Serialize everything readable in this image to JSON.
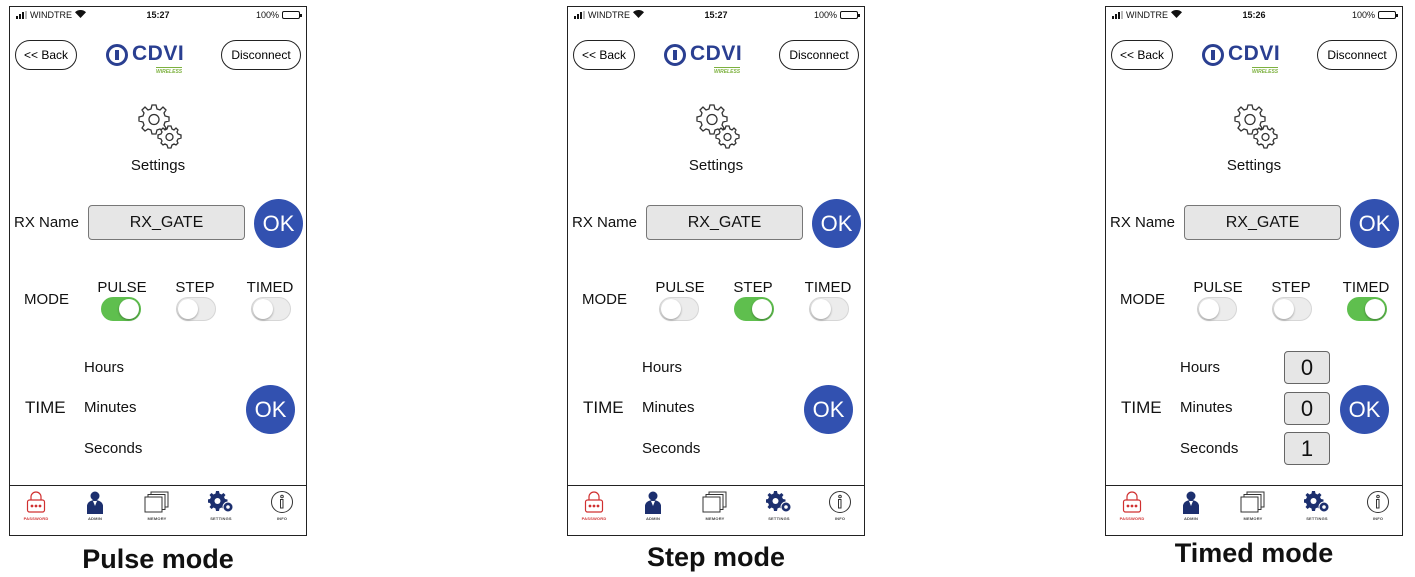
{
  "colors": {
    "brand": "#2a3f91",
    "ok_button": "#3251b0",
    "switch_on": "#5fbf4e",
    "password_tab": "#d03030"
  },
  "screens": [
    {
      "status": {
        "carrier": "WINDTRE",
        "time": "15:27",
        "battery": "100%",
        "charging": true
      },
      "header": {
        "back_label": "<< Back",
        "disconnect_label": "Disconnect",
        "logo_text": "CDVI",
        "logo_sub": "WIRELESS"
      },
      "settings_title": "Settings",
      "rx": {
        "label": "RX Name",
        "value": "RX_GATE",
        "ok_label": "OK"
      },
      "mode": {
        "label": "MODE",
        "options": [
          "PULSE",
          "STEP",
          "TIMED"
        ],
        "selected": "PULSE"
      },
      "time": {
        "label": "TIME",
        "hours_label": "Hours",
        "minutes_label": "Minutes",
        "seconds_label": "Seconds",
        "hours": null,
        "minutes": null,
        "seconds": null,
        "ok_label": "OK"
      },
      "tabs": [
        "PASSWORD",
        "ADMIN",
        "MEMORY",
        "SETTINGS",
        "INFO"
      ],
      "active_tab": "PASSWORD",
      "caption": "Pulse mode"
    },
    {
      "status": {
        "carrier": "WINDTRE",
        "time": "15:27",
        "battery": "100%",
        "charging": true
      },
      "header": {
        "back_label": "<< Back",
        "disconnect_label": "Disconnect",
        "logo_text": "CDVI",
        "logo_sub": "WIRELESS"
      },
      "settings_title": "Settings",
      "rx": {
        "label": "RX Name",
        "value": "RX_GATE",
        "ok_label": "OK"
      },
      "mode": {
        "label": "MODE",
        "options": [
          "PULSE",
          "STEP",
          "TIMED"
        ],
        "selected": "STEP"
      },
      "time": {
        "label": "TIME",
        "hours_label": "Hours",
        "minutes_label": "Minutes",
        "seconds_label": "Seconds",
        "hours": null,
        "minutes": null,
        "seconds": null,
        "ok_label": "OK"
      },
      "tabs": [
        "PASSWORD",
        "ADMIN",
        "MEMORY",
        "SETTINGS",
        "INFO"
      ],
      "active_tab": "PASSWORD",
      "caption": "Step mode"
    },
    {
      "status": {
        "carrier": "WINDTRE",
        "time": "15:26",
        "battery": "100%",
        "charging": false
      },
      "header": {
        "back_label": "<< Back",
        "disconnect_label": "Disconnect",
        "logo_text": "CDVI",
        "logo_sub": "WIRELESS"
      },
      "settings_title": "Settings",
      "rx": {
        "label": "RX Name",
        "value": "RX_GATE",
        "ok_label": "OK"
      },
      "mode": {
        "label": "MODE",
        "options": [
          "PULSE",
          "STEP",
          "TIMED"
        ],
        "selected": "TIMED"
      },
      "time": {
        "label": "TIME",
        "hours_label": "Hours",
        "minutes_label": "Minutes",
        "seconds_label": "Seconds",
        "hours": "0",
        "minutes": "0",
        "seconds": "1",
        "ok_label": "OK"
      },
      "tabs": [
        "PASSWORD",
        "ADMIN",
        "MEMORY",
        "SETTINGS",
        "INFO"
      ],
      "active_tab": "PASSWORD",
      "caption": "Timed mode"
    }
  ]
}
